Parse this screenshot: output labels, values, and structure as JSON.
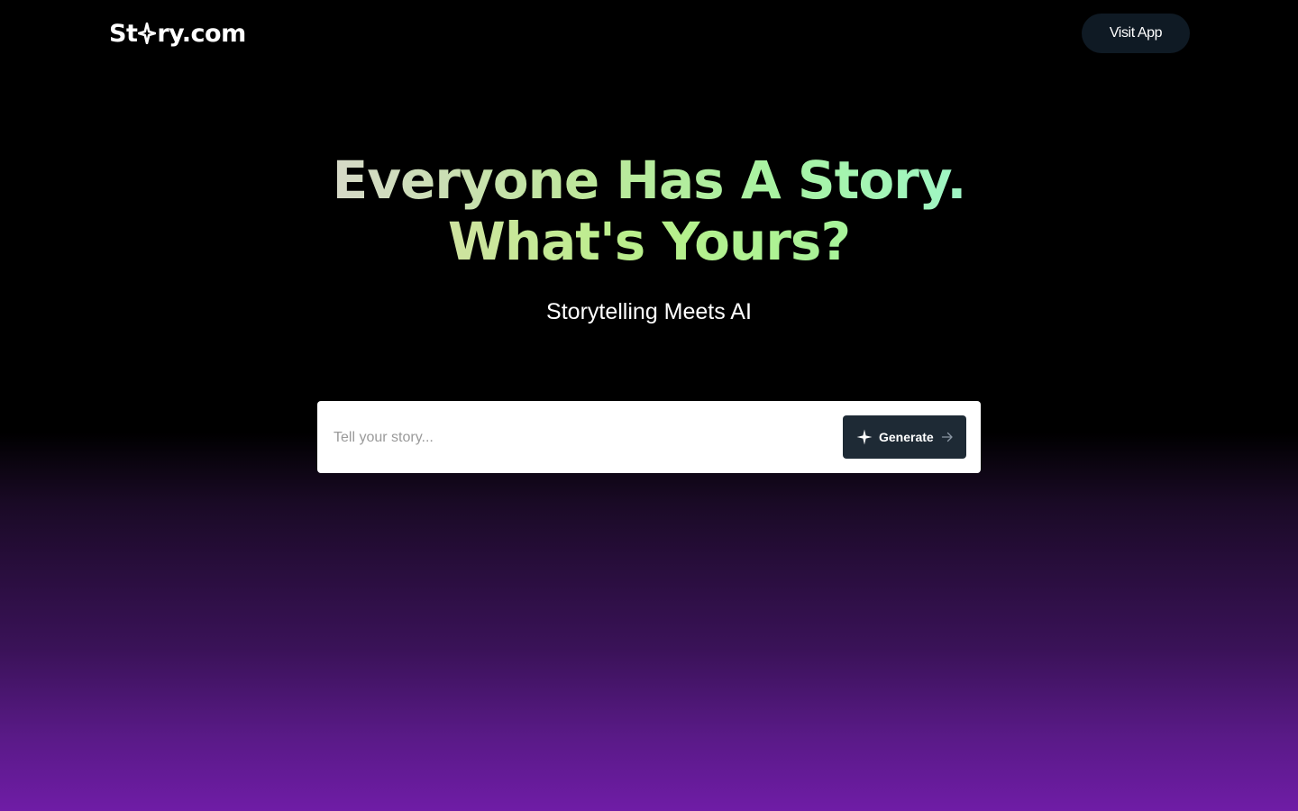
{
  "header": {
    "logo_prefix": "St",
    "logo_suffix": "ry.com",
    "visit_app_label": "Visit App"
  },
  "hero": {
    "headline_line1": "Everyone Has A Story.",
    "headline_line2": "What's Yours?",
    "subtitle": "Storytelling Meets AI"
  },
  "prompt": {
    "placeholder": "Tell your story...",
    "value": "",
    "generate_label": "Generate",
    "generate_icon": "sparkle-icon",
    "arrow_icon": "arrow-right-icon"
  },
  "colors": {
    "background_top": "#000000",
    "background_bottom": "#6f1ca6",
    "button_dark": "#1e2a35",
    "headline_green": "#a8f3a2"
  }
}
